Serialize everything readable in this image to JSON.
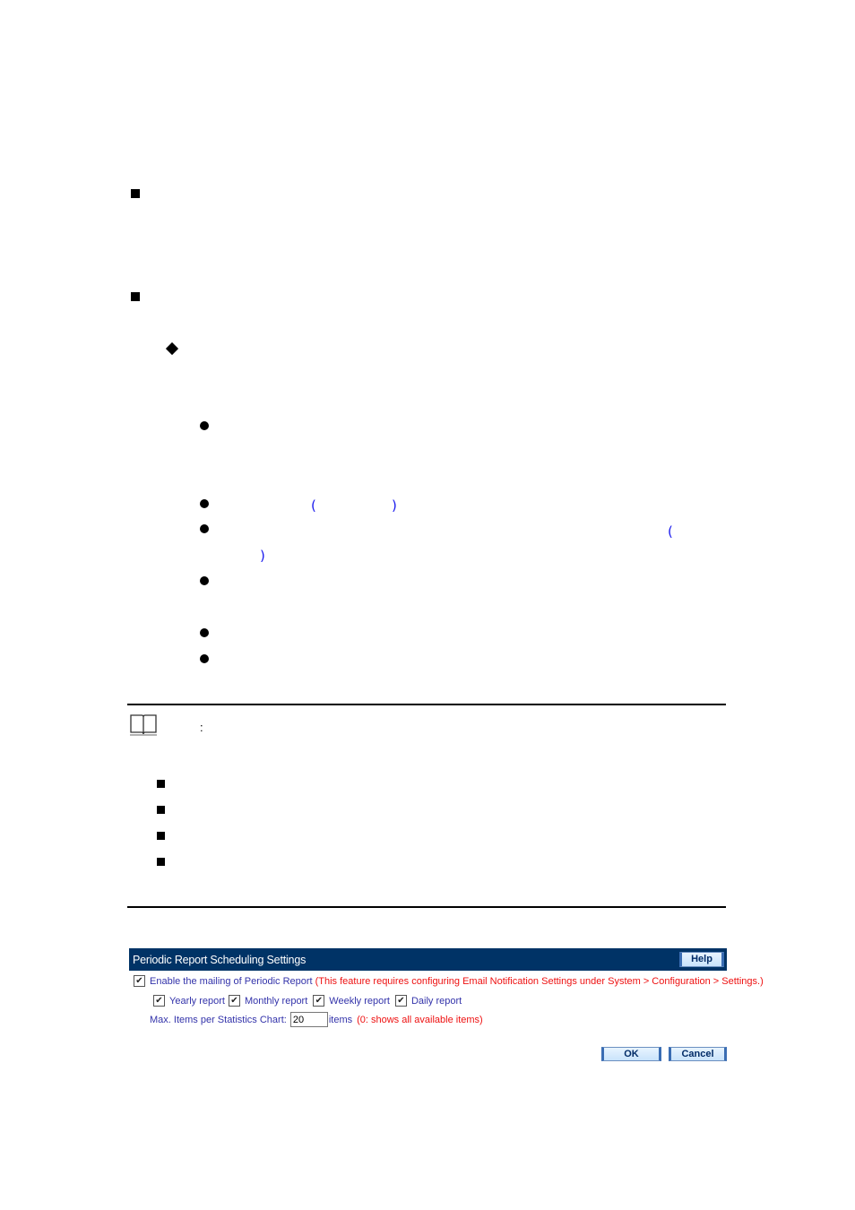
{
  "document": {
    "note_colon": ":",
    "parens": {
      "open": "(",
      "close": ")"
    }
  },
  "panel": {
    "title": "Periodic Report Scheduling Settings",
    "help_label": "Help",
    "enable": {
      "checked": true,
      "label": "Enable the mailing of Periodic Report",
      "warning": "(This feature requires configuring Email Notification Settings under System > Configuration > Settings.)"
    },
    "reports": [
      {
        "label": "Yearly report",
        "checked": true
      },
      {
        "label": "Monthly report",
        "checked": true
      },
      {
        "label": "Weekly report",
        "checked": true
      },
      {
        "label": "Daily report",
        "checked": true
      }
    ],
    "max_items": {
      "label": "Max. Items per Statistics Chart:",
      "value": "20",
      "unit": "items",
      "hint": "(0: shows all available items)"
    },
    "ok_label": "OK",
    "cancel_label": "Cancel"
  },
  "colors": {
    "header_bg": "#003366",
    "label_blue": "#3333aa",
    "warning_red": "#ee1111",
    "paren_blue": "#1a1aee"
  }
}
